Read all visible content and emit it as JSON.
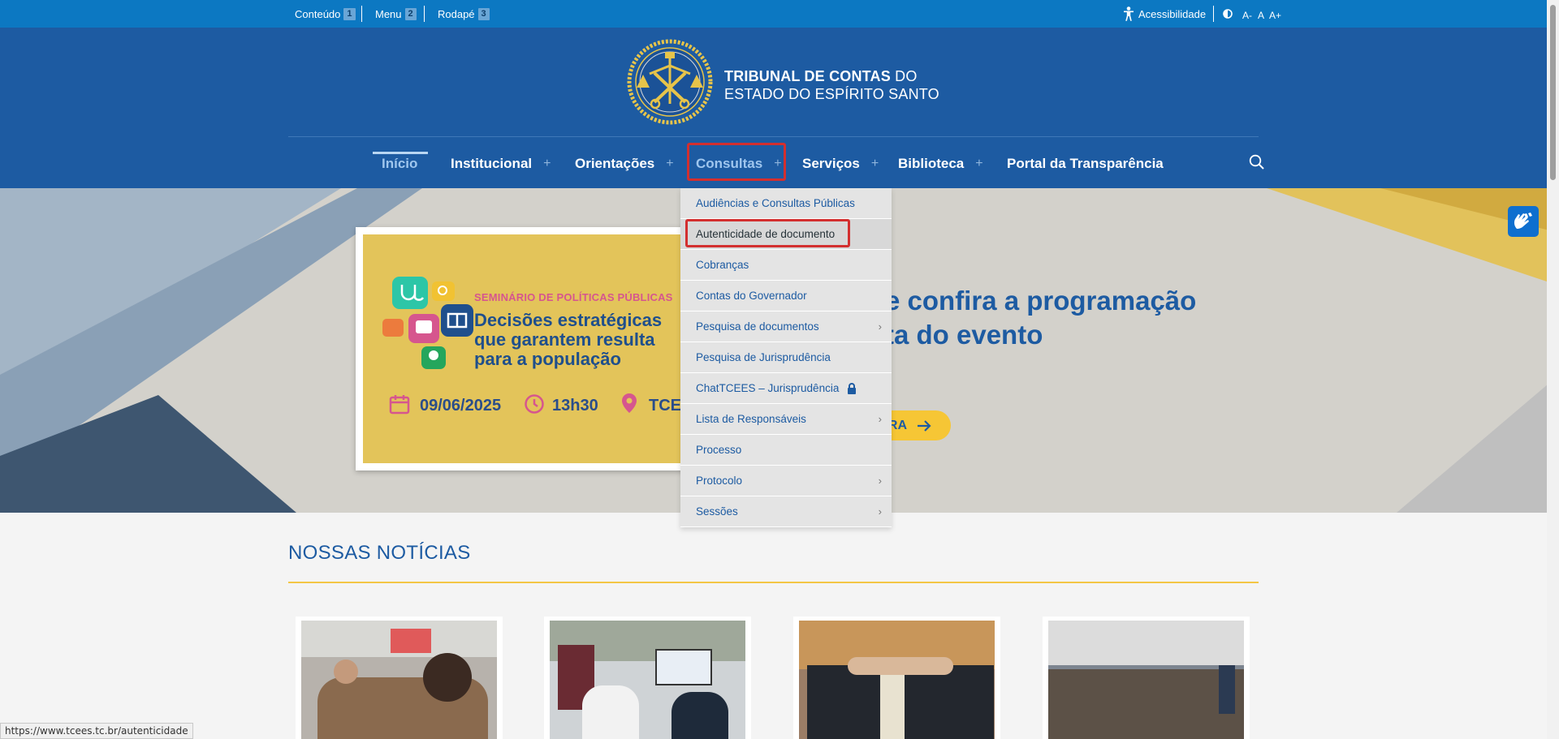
{
  "topbar": {
    "skip": [
      {
        "label": "Conteúdo",
        "key": "1"
      },
      {
        "label": "Menu",
        "key": "2"
      },
      {
        "label": "Rodapé",
        "key": "3"
      }
    ],
    "accessibility": "Acessibilidade",
    "font_small": "A-",
    "font_normal": "A",
    "font_large": "A+"
  },
  "header": {
    "org_line1_bold": "TRIBUNAL DE CONTAS",
    "org_line1_rest": " DO",
    "org_line2": "ESTADO DO ESPÍRITO SANTO"
  },
  "nav": {
    "home": "Início",
    "institucional": "Institucional",
    "orientacoes": "Orientações",
    "consultas": "Consultas",
    "servicos": "Serviços",
    "biblioteca": "Biblioteca",
    "transparencia": "Portal da Transparência",
    "plus": "+"
  },
  "dropdown": [
    "Audiências e Consultas Públicas",
    "Autenticidade de documento",
    "Cobranças",
    "Contas do Governador",
    "Pesquisa de documentos",
    "Pesquisa de Jurisprudência",
    "ChatTCEES – Jurisprudência",
    "Lista de Responsáveis",
    "Processo",
    "Protocolo",
    "Sessões"
  ],
  "hero": {
    "seminar": "SEMINÁRIO DE POLÍTICAS PÚBLICAS",
    "decisions": [
      "Decisões estratégicas",
      "que garantem resulta",
      "para a população"
    ],
    "date": "09/06/2025",
    "time": "13h30",
    "place": "TCE",
    "title_line1": "e confira a programação",
    "title_line2": "ta do evento",
    "button": "RA"
  },
  "news": {
    "title": "NOSSAS NOTÍCIAS"
  },
  "status": "https://www.tcees.tc.br/autenticidade",
  "colors": {
    "topbar": "#0c78c2",
    "header": "#1d5ba2",
    "accent": "#f3c645",
    "highlight": "#d32f2f"
  }
}
